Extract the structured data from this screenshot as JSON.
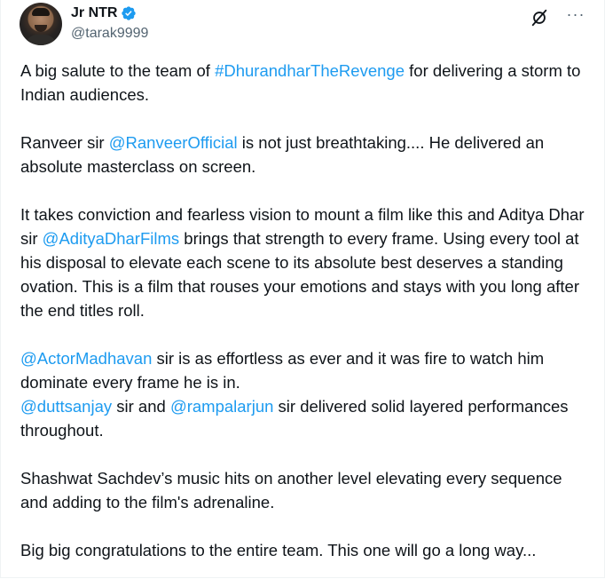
{
  "author": {
    "display_name": "Jr NTR",
    "handle": "@tarak9999"
  },
  "icons": {
    "verified": "verified-badge-icon",
    "grok": "grok-icon",
    "more": "more-icon"
  },
  "colors": {
    "link": "#1d9bf0",
    "text": "#0f1419",
    "secondary": "#536471"
  },
  "more_label": "···",
  "tweet": {
    "p1": {
      "t1": "A big salute to the team of ",
      "l1": "#DhurandharTheRevenge",
      "t2": " for delivering a storm to Indian audiences."
    },
    "p2": {
      "t1": "Ranveer sir ",
      "l1": "@RanveerOfficial",
      "t2": " is not just breathtaking.... He delivered an absolute masterclass  on screen."
    },
    "p3": {
      "t1": "It takes conviction and fearless vision to mount a film like this and Aditya Dhar sir ",
      "l1": "@AdityaDharFilms",
      "t2": " brings that strength to every frame. Using every tool at his disposal to elevate each scene to its absolute best deserves a standing ovation. This is a film that rouses your emotions and stays with you long after the end titles roll."
    },
    "p4": {
      "l1": "@ActorMadhavan",
      "t1": " sir is as effortless as ever and it was fire to watch him dominate every frame he is in."
    },
    "p5": {
      "l1": "@duttsanjay",
      "t1": " sir and ",
      "l2": "@rampalarjun",
      "t2": " sir delivered solid layered performances throughout."
    },
    "p6": {
      "t1": "Shashwat Sachdev’s music hits on another level elevating every sequence and adding to the film's adrenaline."
    },
    "p7": {
      "t1": "Big big congratulations to the entire team. This one will go a long way..."
    }
  }
}
